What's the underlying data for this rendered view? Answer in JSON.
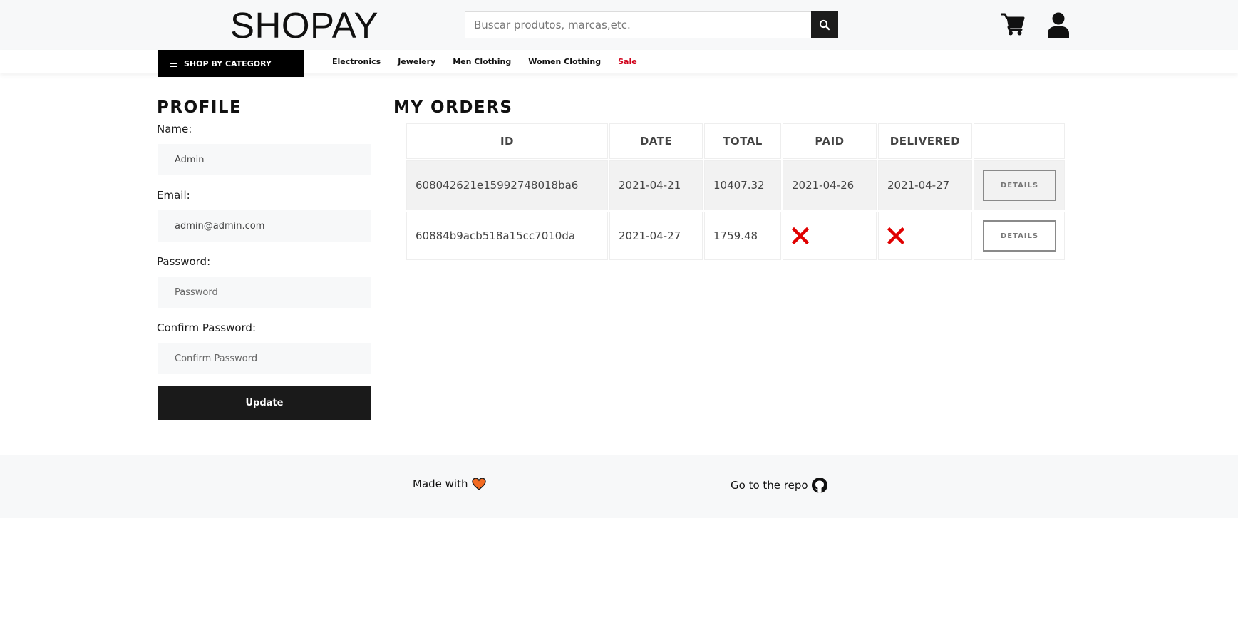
{
  "header": {
    "logo": "SHOPAY",
    "search_placeholder": "Buscar produtos, marcas,etc."
  },
  "nav": {
    "shop_by_category": "SHOP BY CATEGORY",
    "links": [
      "Electronics",
      "Jewelery",
      "Men Clothing",
      "Women Clothing",
      "Sale"
    ]
  },
  "profile": {
    "title": "PROFILE",
    "name_label": "Name:",
    "name_value": "Admin",
    "email_label": "Email:",
    "email_value": "admin@admin.com",
    "password_label": "Password:",
    "password_placeholder": "Password",
    "confirm_label": "Confirm Password:",
    "confirm_placeholder": "Confirm Password",
    "update_label": "Update"
  },
  "orders": {
    "title": "MY ORDERS",
    "headers": [
      "ID",
      "DATE",
      "TOTAL",
      "PAID",
      "DELIVERED",
      ""
    ],
    "rows": [
      {
        "id": "608042621e15992748018ba6",
        "date": "2021-04-21",
        "total": "10407.32",
        "paid": "2021-04-26",
        "delivered": "2021-04-27",
        "action": "DETAILS"
      },
      {
        "id": "60884b9acb518a15cc7010da",
        "date": "2021-04-27",
        "total": "1759.48",
        "paid": "",
        "delivered": "",
        "action": "DETAILS"
      }
    ]
  },
  "footer": {
    "made_with": "Made with",
    "repo": "Go to the repo"
  },
  "colors": {
    "accent_dark": "#1a1a1a",
    "sale": "#d0021b",
    "not_paid_x": "#e00000",
    "heart": "#f26a21"
  }
}
